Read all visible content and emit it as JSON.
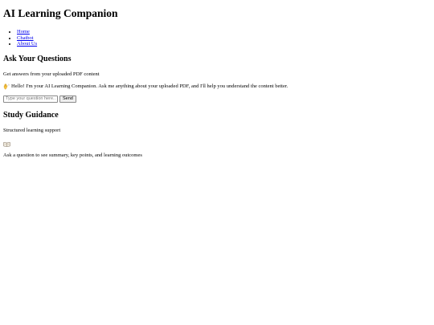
{
  "app": {
    "title": "AI Learning Companion"
  },
  "nav": {
    "items": [
      {
        "label": "Home"
      },
      {
        "label": "Chatbot"
      },
      {
        "label": "About Us"
      }
    ]
  },
  "ask": {
    "heading": "Ask Your Questions",
    "subtitle": "Get answers from your uploaded PDF content",
    "greeting_icon": "waving-hand-icon",
    "greeting": "Hello! I'm your AI Learning Companion. Ask me anything about your uploaded PDF, and I'll help you understand the content better.",
    "input_placeholder": "Type your question here...",
    "send_label": "Send"
  },
  "study": {
    "heading": "Study Guidance",
    "subtitle": "Structured learning support",
    "icon": "open-book-icon",
    "hint": "Ask a question to see summary, key points, and learning outcomes"
  }
}
